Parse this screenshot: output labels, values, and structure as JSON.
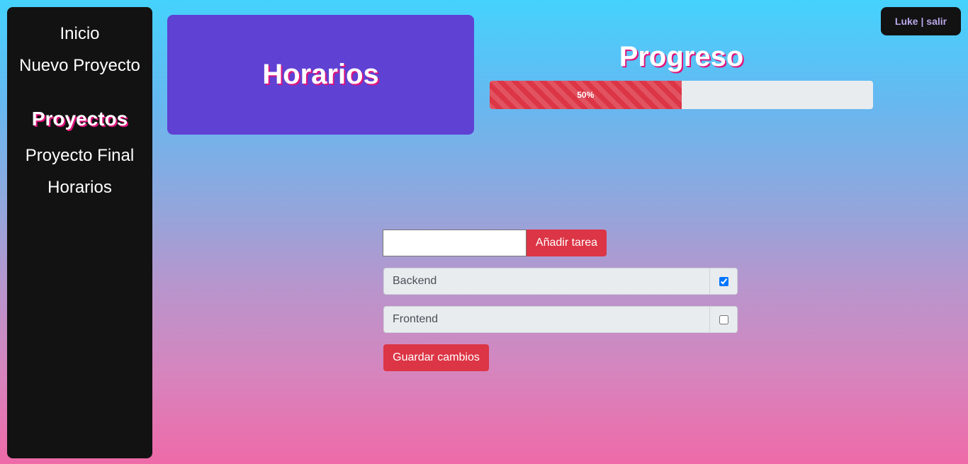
{
  "sidebar": {
    "links": [
      {
        "label": "Inicio"
      },
      {
        "label": "Nuevo Proyecto"
      }
    ],
    "projects_heading": "Proyectos",
    "projects": [
      {
        "label": "Proyecto Final"
      },
      {
        "label": "Horarios"
      }
    ]
  },
  "project": {
    "title": "Horarios"
  },
  "progress": {
    "title": "Progreso",
    "value_label": "50%",
    "value": 50,
    "color": "#dc3545"
  },
  "user": {
    "label": "Luke | salir"
  },
  "task_form": {
    "input_value": "",
    "input_placeholder": "",
    "add_button_label": "Añadir tarea"
  },
  "tasks": [
    {
      "name": "Backend",
      "done": true
    },
    {
      "name": "Frontend",
      "done": false
    }
  ],
  "save_button_label": "Guardar cambios",
  "colors": {
    "sidebar_bg": "#121212",
    "title_card_bg": "#5f41d3",
    "accent_red": "#dc3545",
    "text_shadow": "#e0147c"
  }
}
